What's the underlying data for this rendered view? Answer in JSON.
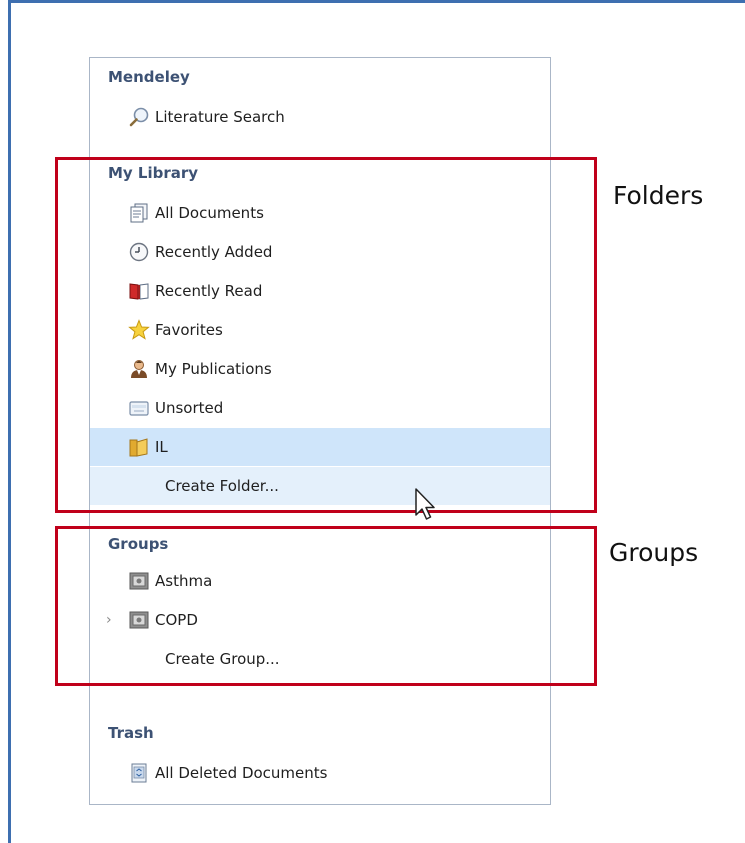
{
  "sections": {
    "mendeley": {
      "title": "Mendeley",
      "literature_search": "Literature Search"
    },
    "my_library": {
      "title": "My Library",
      "all_documents": "All Documents",
      "recently_added": "Recently Added",
      "recently_read": "Recently Read",
      "favorites": "Favorites",
      "my_publications": "My Publications",
      "unsorted": "Unsorted",
      "il": "IL",
      "create_folder": "Create Folder..."
    },
    "groups": {
      "title": "Groups",
      "asthma": "Asthma",
      "copd": "COPD",
      "create_group": "Create Group..."
    },
    "trash": {
      "title": "Trash",
      "all_deleted": "All Deleted Documents"
    }
  },
  "annotations": {
    "folders": "Folders",
    "groups": "Groups"
  },
  "colors": {
    "frame": "#3e6fb0",
    "highlight_box": "#c0001a",
    "selected_row": "#cfe5fa",
    "hover_row": "#e4f0fb",
    "section_title": "#3d5274"
  }
}
